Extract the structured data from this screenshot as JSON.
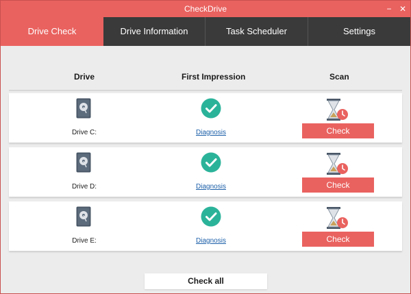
{
  "window": {
    "title": "CheckDrive",
    "minimize_glyph": "−",
    "close_glyph": "✕"
  },
  "tabs": [
    {
      "label": "Drive Check",
      "active": true
    },
    {
      "label": "Drive Information",
      "active": false
    },
    {
      "label": "Task Scheduler",
      "active": false
    },
    {
      "label": "Settings",
      "active": false
    }
  ],
  "table": {
    "headers": {
      "drive": "Drive",
      "impression": "First Impression",
      "scan": "Scan"
    },
    "rows": [
      {
        "drive": "Drive C:",
        "icon": "hard-drive-icon",
        "status_icon": "check-circle-icon",
        "diagnosis": "Diagnosis",
        "scan_icon": "hourglass-clock-icon",
        "action": "Check"
      },
      {
        "drive": "Drive D:",
        "icon": "hard-drive-icon",
        "status_icon": "check-circle-icon",
        "diagnosis": "Diagnosis",
        "scan_icon": "hourglass-clock-icon",
        "action": "Check"
      },
      {
        "drive": "Drive E:",
        "icon": "hard-drive-icon",
        "status_icon": "check-circle-icon",
        "diagnosis": "Diagnosis",
        "scan_icon": "hourglass-clock-icon",
        "action": "Check"
      }
    ]
  },
  "footer": {
    "check_all_label": "Check all"
  },
  "colors": {
    "accent": "#e9625f",
    "tab_bar": "#3a3a3a",
    "success": "#2bb39a",
    "link": "#1a5ea8"
  }
}
